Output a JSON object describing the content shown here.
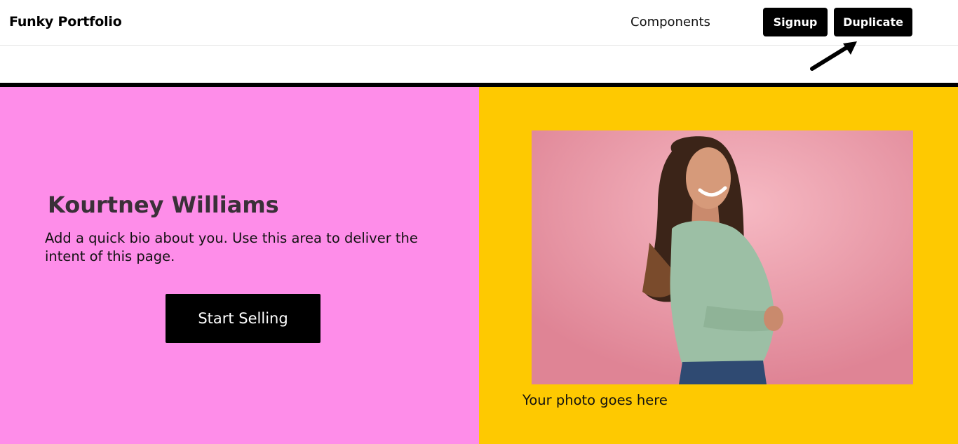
{
  "header": {
    "brand": "Funky Portfolio",
    "nav_components": "Components",
    "signup_label": "Signup",
    "duplicate_label": "Duplicate"
  },
  "hero": {
    "name": "Kourtney Williams",
    "bio": "Add a quick bio about you. Use this area to deliver the intent of this page.",
    "cta_label": "Start Selling",
    "photo_caption": "Your photo goes here"
  },
  "colors": {
    "left_panel_bg": "#fe8de9",
    "right_panel_bg": "#fec901",
    "button_bg": "#000000",
    "button_text": "#ffffff"
  },
  "icons": {
    "annotation_arrow": "arrow-up-right-icon"
  }
}
